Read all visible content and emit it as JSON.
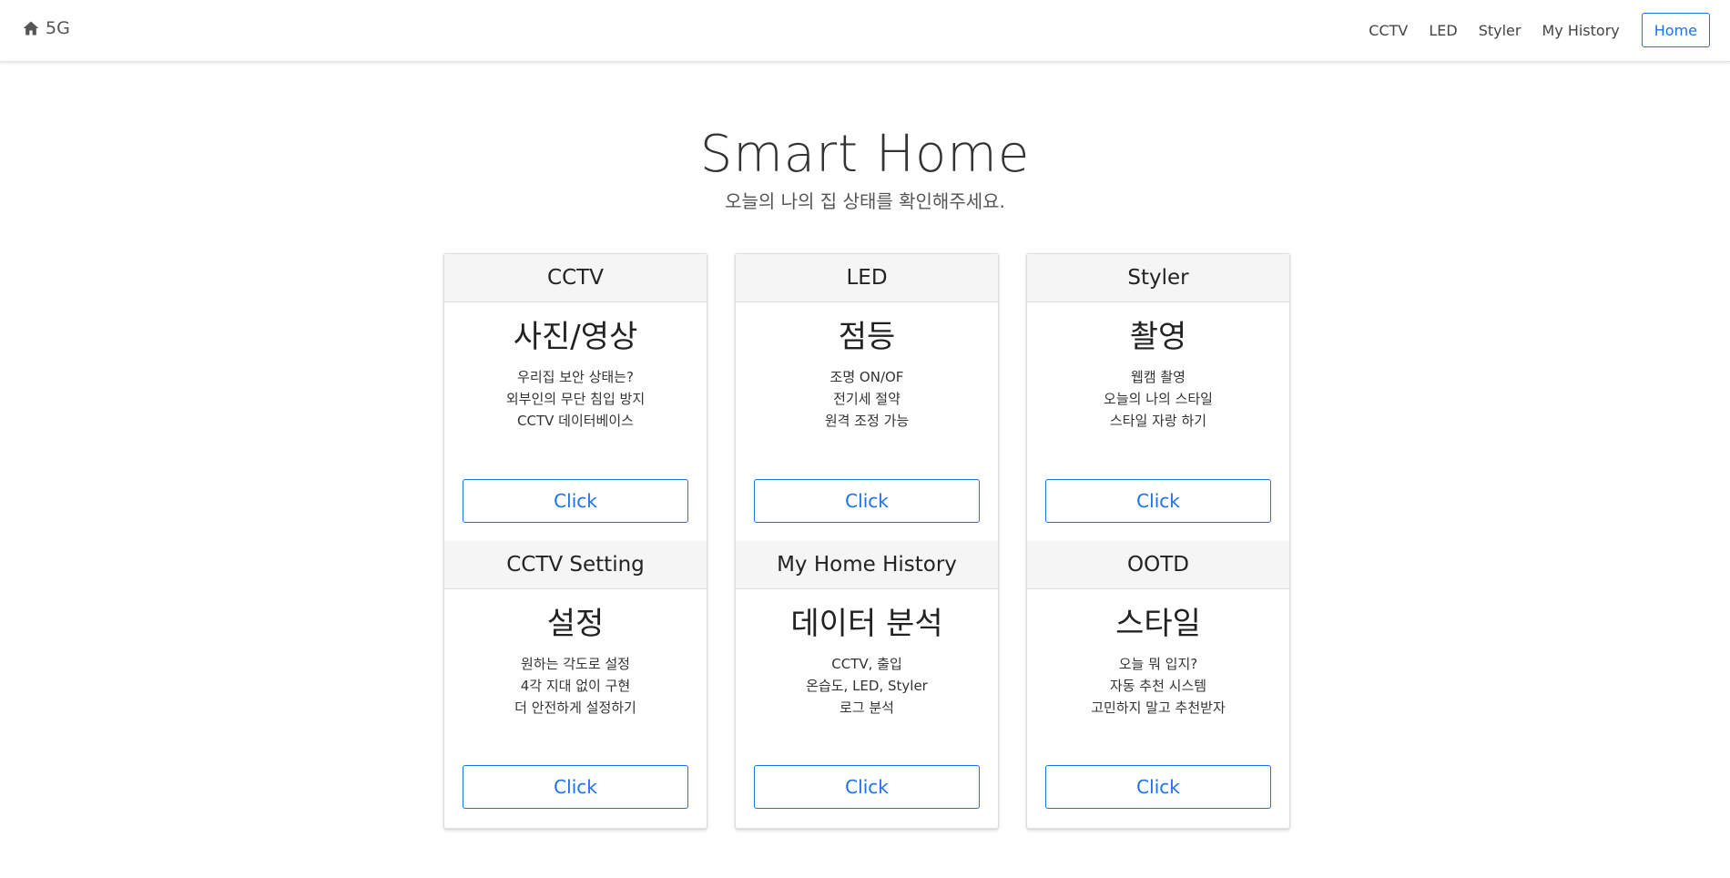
{
  "nav": {
    "brand": "5G",
    "links": [
      "CCTV",
      "LED",
      "Styler",
      "My History"
    ],
    "home": "Home"
  },
  "hero": {
    "title": "Smart Home",
    "subtitle": "오늘의 나의 집 상태를 확인해주세요."
  },
  "cards": [
    {
      "header": "CCTV",
      "title": "사진/영상",
      "text": "우리집 보안 상태는?\n외부인의 무단 침입 방지\nCCTV 데이터베이스",
      "button": "Click"
    },
    {
      "header": "LED",
      "title": "점등",
      "text": "조명 ON/OF\n전기세 절약\n원격 조정 가능",
      "button": "Click"
    },
    {
      "header": "Styler",
      "title": "촬영",
      "text": "웹캠 촬영\n오늘의 나의 스타일\n스타일 자랑 하기",
      "button": "Click"
    },
    {
      "header": "CCTV Setting",
      "title": "설정",
      "text": "원하는 각도로 설정\n4각 지대 없이 구현\n더 안전하게 설정하기",
      "button": "Click"
    },
    {
      "header": "My Home History",
      "title": "데이터 분석",
      "text": "CCTV, 출입\n온습도, LED, Styler\n로그 분석",
      "button": "Click"
    },
    {
      "header": "OOTD",
      "title": "스타일",
      "text": "오늘 뭐 입지?\n자동 추천 시스템\n고민하지 말고 추천받자",
      "button": "Click"
    }
  ],
  "colors": {
    "accent": "#1a73e8",
    "card_header_bg": "#f5f5f5"
  }
}
